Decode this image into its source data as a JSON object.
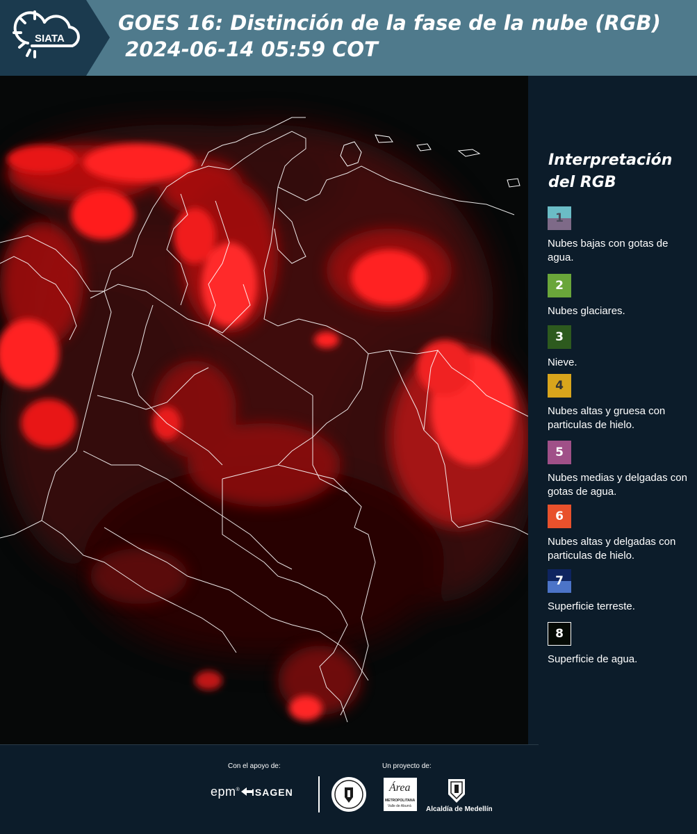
{
  "header": {
    "logo_text": "SIATA",
    "title_line1": "GOES 16: Distinción de la fase de la nube (RGB)",
    "title_line2": " 2024-06-14 05:59 COT"
  },
  "map": {
    "description_icon": "satellite-rgb-image",
    "base_color": "#060808",
    "cloud_color": "#ff1a1a",
    "border_color": "#ffffff"
  },
  "legend": {
    "title": "Interpretación del RGB",
    "items": [
      {
        "number": "1",
        "label": "Nubes bajas con gotas de agua.",
        "color_top": "#6bbcc6",
        "color_bottom": "#7e6a88",
        "num_color": "#4a4a5a"
      },
      {
        "number": "2",
        "label": "Nubes glaciares.",
        "color_top": "#6aa63a",
        "color_bottom": "#6aa63a",
        "num_color": "#ffffff"
      },
      {
        "number": "3",
        "label": "Nieve.",
        "color_top": "#2d5a1e",
        "color_bottom": "#2d5a1e",
        "num_color": "#ffffff"
      },
      {
        "number": "4",
        "label": "Nubes altas y gruesa con particulas de hielo.",
        "color_top": "#d9a51c",
        "color_bottom": "#d9a51c",
        "num_color": "#333333"
      },
      {
        "number": "5",
        "label": "Nubes medias y delgadas con gotas de agua.",
        "color_top": "#a05088",
        "color_bottom": "#a05088",
        "num_color": "#ffffff"
      },
      {
        "number": "6",
        "label": "Nubes altas y delgadas con particulas de hielo.",
        "color_top": "#e8512c",
        "color_bottom": "#e8512c",
        "num_color": "#ffffff"
      },
      {
        "number": "7",
        "label": "Superficie terreste.",
        "color_top": "#0e2460",
        "color_bottom": "#4c74c8",
        "num_color": "#ffffff"
      },
      {
        "number": "8",
        "label": "Superficie de agua.",
        "color_top": "#050a05",
        "color_bottom": "#050a05",
        "num_color": "#ffffff"
      }
    ]
  },
  "footer": {
    "support_label": "Con el apoyo de:",
    "project_label": "Un proyecto de:",
    "epm_text": "epm",
    "isagen_text": "ISAGEN",
    "area_text": "Área",
    "metropolitana_text": "METROPOLITANA",
    "valle_text": "Valle de Aburrá",
    "alcaldia_text": "Alcaldía de Medellín"
  }
}
